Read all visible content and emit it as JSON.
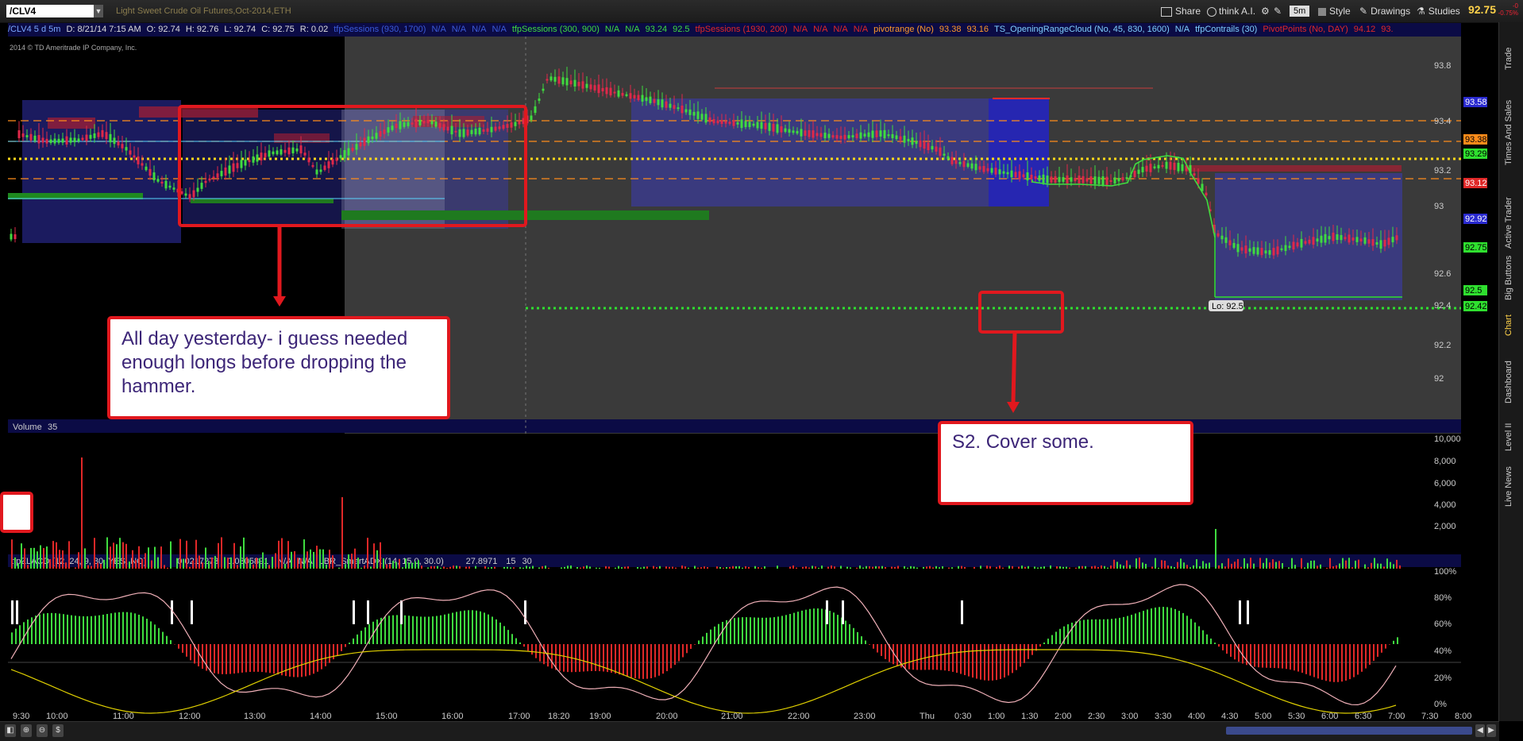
{
  "header": {
    "symbol": "/CLV4",
    "title": "Light Sweet Crude Oil Futures,Oct-2014,ETH",
    "share": "Share",
    "thinkai": "think A.I.",
    "timeframe": "5m",
    "style": "Style",
    "drawings": "Drawings",
    "studies": "Studies",
    "last_price": "92.75",
    "change_top": "-0",
    "change_bottom": "-0.75%"
  },
  "studybar": [
    {
      "text": "/CLV4 5 d 5m",
      "color": "#7aa7ff"
    },
    {
      "text": "D: 8/21/14 7:15 AM",
      "color": "#ddd"
    },
    {
      "text": "O: 92.74",
      "color": "#ddd"
    },
    {
      "text": "H: 92.76",
      "color": "#ddd"
    },
    {
      "text": "L: 92.74",
      "color": "#ddd"
    },
    {
      "text": "C: 92.75",
      "color": "#ddd"
    },
    {
      "text": "R: 0.02",
      "color": "#ddd"
    },
    {
      "text": "tfpSessions (930, 1700)",
      "color": "#3b5bd9"
    },
    {
      "text": "N/A",
      "color": "#3b5bd9"
    },
    {
      "text": "N/A",
      "color": "#3b5bd9"
    },
    {
      "text": "N/A",
      "color": "#3b5bd9"
    },
    {
      "text": "N/A",
      "color": "#3b5bd9"
    },
    {
      "text": "tfpSessions (300, 900)",
      "color": "#3fdc3f"
    },
    {
      "text": "N/A",
      "color": "#3fdc3f"
    },
    {
      "text": "N/A",
      "color": "#3fdc3f"
    },
    {
      "text": "93.24",
      "color": "#3fdc3f"
    },
    {
      "text": "92.5",
      "color": "#3fdc3f"
    },
    {
      "text": "tfpSessions (1930, 200)",
      "color": "#e02828"
    },
    {
      "text": "N/A",
      "color": "#e02828"
    },
    {
      "text": "N/A",
      "color": "#e02828"
    },
    {
      "text": "N/A",
      "color": "#e02828"
    },
    {
      "text": "N/A",
      "color": "#e02828"
    },
    {
      "text": "pivotrange (No)",
      "color": "#ff9a2a"
    },
    {
      "text": "93.38",
      "color": "#ff9a2a"
    },
    {
      "text": "93.16",
      "color": "#ff9a2a"
    },
    {
      "text": "TS_OpeningRangeCloud (No, 45, 830, 1600)",
      "color": "#7fd0ff"
    },
    {
      "text": "N/A",
      "color": "#7fd0ff"
    },
    {
      "text": "tfpContrails (30)",
      "color": "#7fd0ff"
    },
    {
      "text": "PivotPoints (No, DAY)",
      "color": "#e02828"
    },
    {
      "text": "94.12",
      "color": "#e02828"
    },
    {
      "text": "93.",
      "color": "#e02828"
    }
  ],
  "copyright": "2014 © TD Ameritrade IP Company, Inc.",
  "sidebar": [
    "Trade",
    "Times And Sales",
    "Active Trader",
    "Big Buttons",
    "Chart",
    "Dashboard",
    "Level II",
    "Live News"
  ],
  "volume_header": {
    "label": "Volume",
    "value": "35"
  },
  "indicator_header": [
    {
      "text": "tfpZLACD (12, 24, 9, 30, YES, NO)",
      "color": "#2fb82f"
    },
    {
      "text": "0.0217273",
      "color": "#2fb82f"
    },
    {
      "text": "0.0305891",
      "color": "#ffffff"
    },
    {
      "text": "N/A",
      "color": "#ddd"
    },
    {
      "text": "N/A",
      "color": "#ddd"
    },
    {
      "text": "LBR_SmartADX (14, 15.0, 30.0)",
      "color": "#ffd24a"
    },
    {
      "text": "27.8971",
      "color": "#ffd24a"
    },
    {
      "text": "15",
      "color": "#ddd"
    },
    {
      "text": "30",
      "color": "#ddd"
    }
  ],
  "annotations": {
    "left": "All day yesterday- i guess needed enough longs before dropping the hammer.",
    "right": "S2. Cover some."
  },
  "price_axis": [
    "93.8",
    "93.4",
    "93.2",
    "93",
    "92.6",
    "92.4",
    "92.2",
    "92"
  ],
  "price_tags": [
    {
      "text": "93.58",
      "bg": "#2a2ad0",
      "fg": "#fff"
    },
    {
      "text": "93.38",
      "bg": "#ff8c1a",
      "fg": "#000"
    },
    {
      "text": "93.29",
      "bg": "#2fe02f",
      "fg": "#000"
    },
    {
      "text": "93.12",
      "bg": "#e02828",
      "fg": "#fff"
    },
    {
      "text": "92.92",
      "bg": "#2a2ad0",
      "fg": "#fff"
    },
    {
      "text": "92.75",
      "bg": "#2fe02f",
      "fg": "#000"
    },
    {
      "text": "92.5",
      "bg": "#2fe02f",
      "fg": "#000"
    },
    {
      "text": "92.42",
      "bg": "#2fe02f",
      "fg": "#000"
    }
  ],
  "lo_label": "Lo: 92.5",
  "volume_axis": [
    "10,000",
    "8,000",
    "6,000",
    "4,000",
    "2,000"
  ],
  "indicator_axis": [
    "100%",
    "80%",
    "60%",
    "40%",
    "20%",
    "0%"
  ],
  "time_axis": [
    "9:30",
    "10:00",
    "11:00",
    "12:00",
    "13:00",
    "14:00",
    "15:00",
    "16:00",
    "17:00",
    "18:20",
    "19:00",
    "20:00",
    "21:00",
    "22:00",
    "23:00",
    "Thu",
    "0:30",
    "1:00",
    "1:30",
    "2:00",
    "2:30",
    "3:00",
    "3:30",
    "4:00",
    "4:30",
    "5:00",
    "5:30",
    "6:00",
    "6:30",
    "7:00",
    "7:30",
    "8:00"
  ],
  "bottom_buttons": [
    "zoom-in",
    "zoom-out",
    "dollar"
  ]
}
